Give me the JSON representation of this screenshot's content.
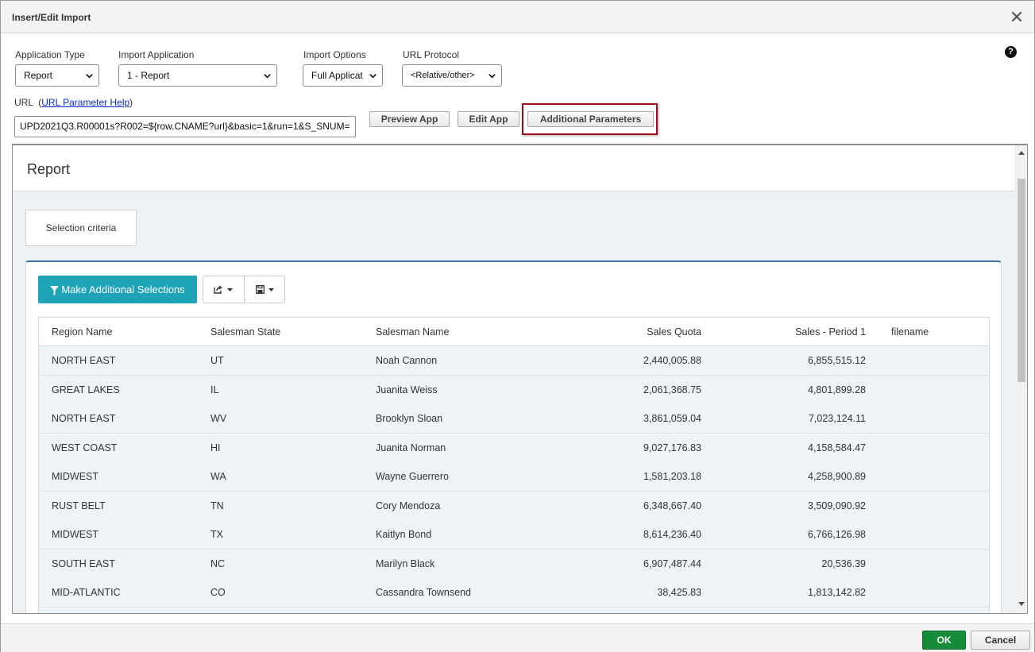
{
  "dialog": {
    "title": "Insert/Edit Import",
    "close_icon": "close-icon",
    "help_icon": "help-icon"
  },
  "form": {
    "application_type": {
      "label": "Application Type",
      "value": "Report"
    },
    "import_application": {
      "label": "Import Application",
      "value": "1 - Report"
    },
    "import_options": {
      "label": "Import Options",
      "value": "Full Applicat"
    },
    "url_protocol": {
      "label": "URL Protocol",
      "value": "<Relative/other>"
    },
    "url_label": "URL",
    "url_help_link": "URL Parameter Help",
    "url_value": "UPD2021Q3.R00001s?R002=${row.CNAME?url}&basic=1&run=1&S_SNUM=",
    "preview_button": "Preview App",
    "edit_button": "Edit App",
    "additional_params_button": "Additional Parameters"
  },
  "report": {
    "heading": "Report",
    "selection_tab": "Selection criteria",
    "make_selections_button": "Make Additional Selections",
    "columns": [
      "Region Name",
      "Salesman State",
      "Salesman Name",
      "Sales Quota",
      "Sales - Period 1",
      "filename"
    ],
    "rows": [
      [
        "NORTH EAST",
        "UT",
        "Noah Cannon",
        "2,440,005.88",
        "6,855,515.12",
        ""
      ],
      [
        "GREAT LAKES",
        "IL",
        "Juanita Weiss",
        "2,061,368.75",
        "4,801,899.28",
        ""
      ],
      [
        "NORTH EAST",
        "WV",
        "Brooklyn Sloan",
        "3,861,059.04",
        "7,023,124.11",
        ""
      ],
      [
        "WEST COAST",
        "HI",
        "Juanita Norman",
        "9,027,176.83",
        "4,158,584.47",
        ""
      ],
      [
        "MIDWEST",
        "WA",
        "Wayne Guerrero",
        "1,581,203.18",
        "4,258,900.89",
        ""
      ],
      [
        "RUST BELT",
        "TN",
        "Cory Mendoza",
        "6,348,667.40",
        "3,509,090.92",
        ""
      ],
      [
        "MIDWEST",
        "TX",
        "Kaitlyn Bond",
        "8,614,236.40",
        "6,766,126.98",
        ""
      ],
      [
        "SOUTH EAST",
        "NC",
        "Marilyn Black",
        "6,907,487.44",
        "20,536.39",
        ""
      ],
      [
        "MID-ATLANTIC",
        "CO",
        "Cassandra Townsend",
        "38,425.83",
        "1,813,142.82",
        ""
      ]
    ]
  },
  "footer": {
    "ok_button": "OK",
    "cancel_button": "Cancel"
  },
  "colors": {
    "ok_green": "#168b3a",
    "teal_button": "#1fa3b6",
    "highlight_red": "#a0101a",
    "link_blue": "#0a2ed2"
  }
}
